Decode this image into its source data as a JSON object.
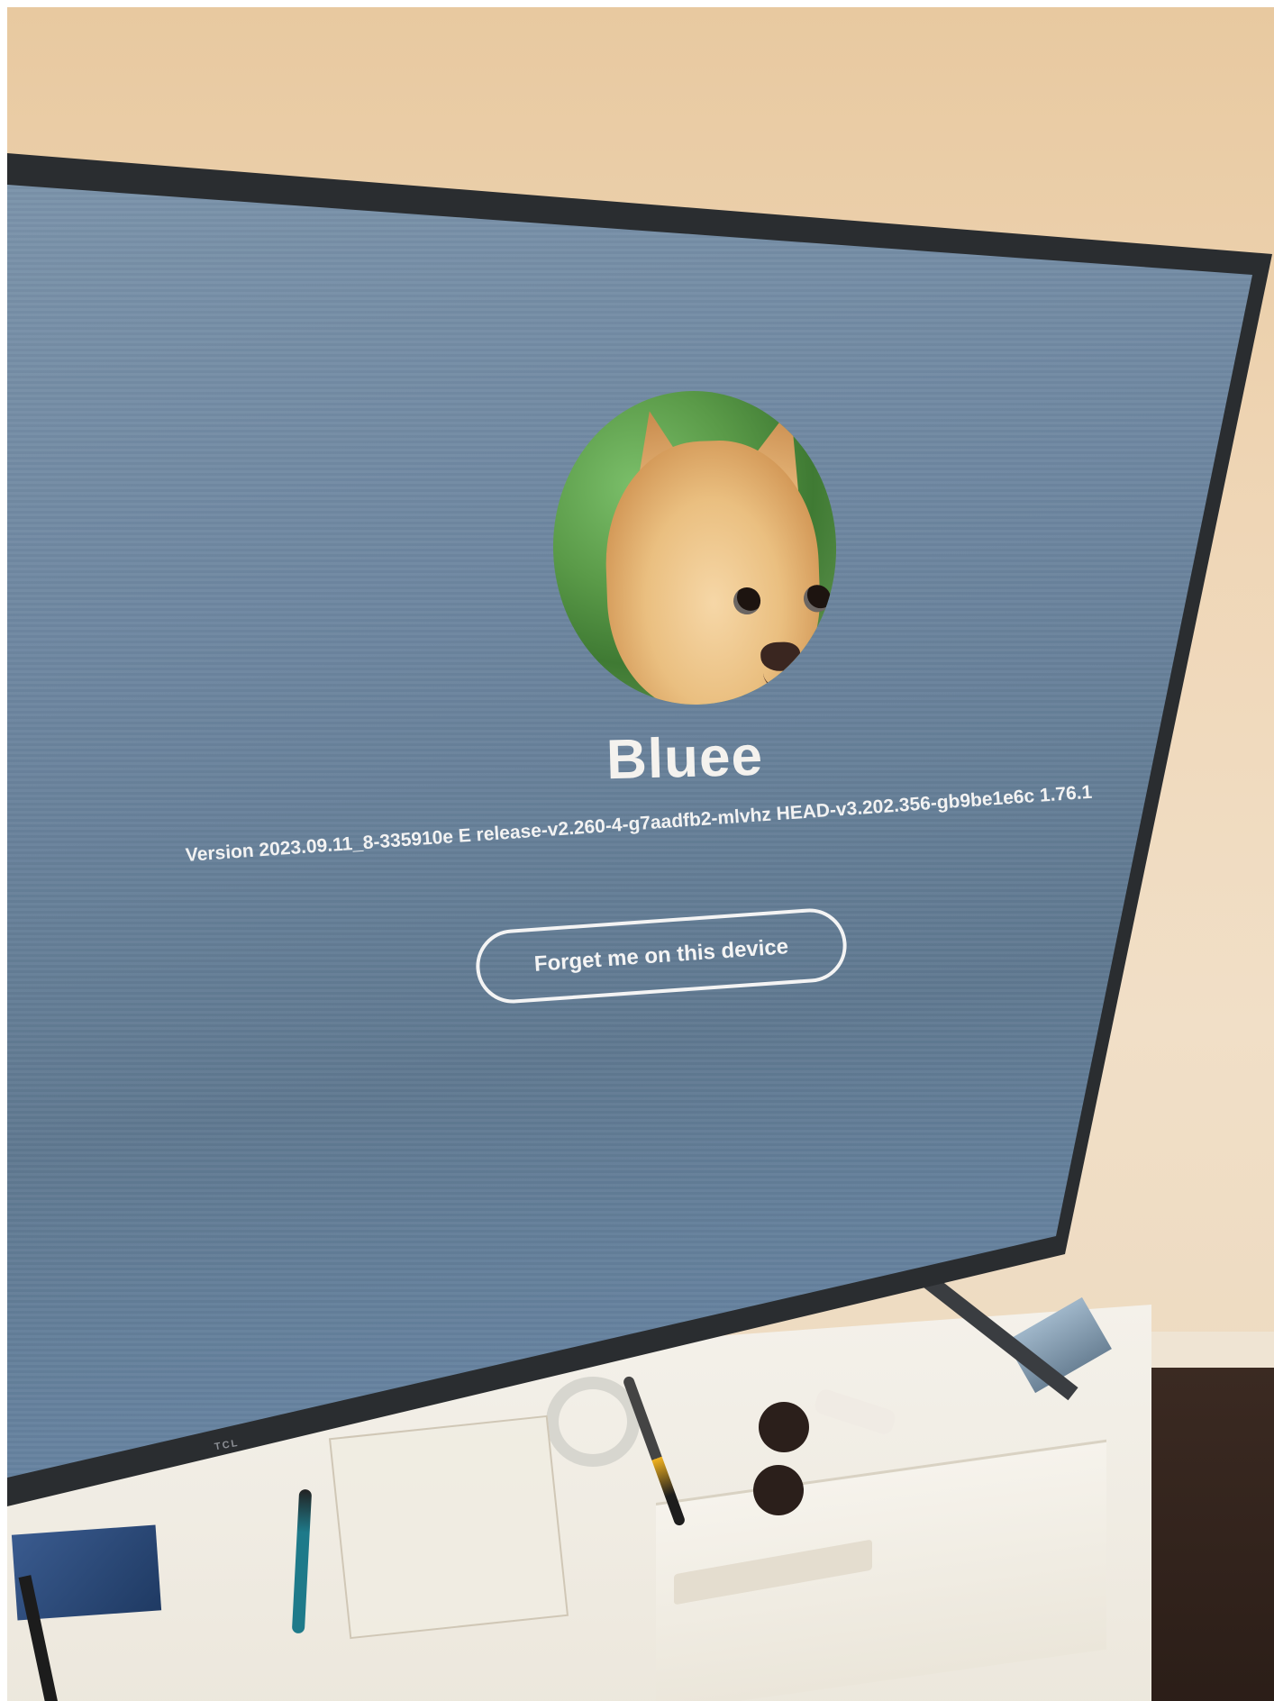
{
  "screen": {
    "profile_name": "Bluee",
    "version_text": "Version 2023.09.11_8-335910e E release-v2.260-4-g7aadfb2-mlvhz HEAD-v3.202.356-gb9be1e6c 1.76.1",
    "forget_button_label": "Forget me on this device"
  },
  "tv": {
    "brand_label": "TCL"
  },
  "colors": {
    "screen_background": "#6d86a0",
    "text": "#f4f2ee",
    "button_border": "#f4f4f4"
  },
  "icons": {
    "avatar": "profile-avatar-dog"
  }
}
